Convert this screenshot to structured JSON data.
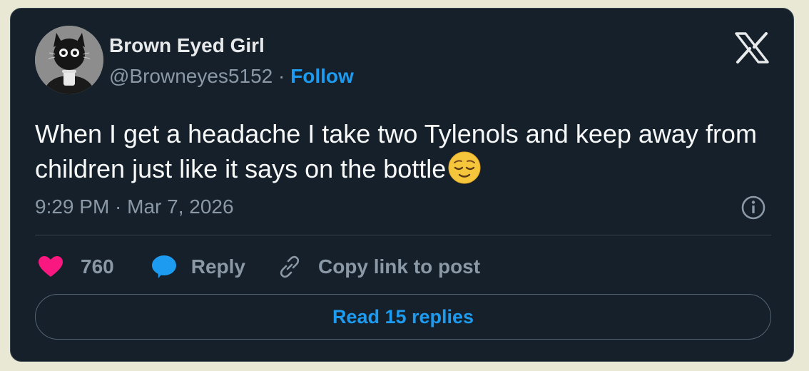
{
  "author": {
    "name": "Brown Eyed Girl",
    "handle": "@Browneyes5152",
    "separator": " · ",
    "follow_label": "Follow"
  },
  "tweet": {
    "text": "When I get a headache I take two Tylenols and keep away from children just like it says on the bottle",
    "emoji": "relieved-face-emoji",
    "timestamp": "9:29 PM · Mar 7, 2026"
  },
  "actions": {
    "like_count": "760",
    "reply_label": "Reply",
    "copy_link_label": "Copy link to post"
  },
  "read_replies_label": "Read 15 replies",
  "colors": {
    "background": "#e8e8d4",
    "card": "#15202b",
    "border": "#38444d",
    "primary_text": "#e7e9ea",
    "secondary_text": "#8b98a5",
    "accent": "#1d9bf0",
    "like": "#f91880"
  },
  "icons": {
    "brand": "x-logo-icon",
    "info": "info-icon",
    "like": "heart-icon",
    "reply": "speech-bubble-icon",
    "copy_link": "link-icon"
  }
}
